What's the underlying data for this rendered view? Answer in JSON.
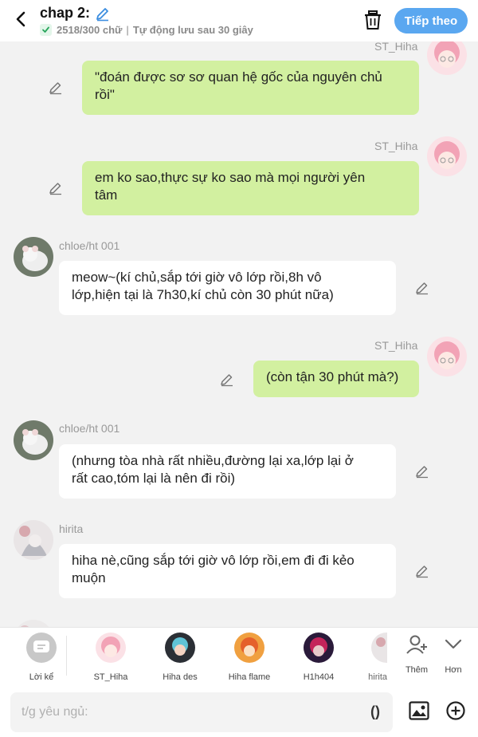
{
  "header": {
    "title": "chap 2:",
    "word_count": "2518/300 chữ",
    "separator": "|",
    "autosave": "Tự động lưu sau 30 giây",
    "next_label": "Tiếp theo",
    "accent": "#5aa7f0"
  },
  "messages": [
    {
      "side": "right",
      "name": "ST_Hiha",
      "lines": [
        "\"đoán được sơ sơ quan hệ gốc của nguyên chủ",
        "rồi\""
      ]
    },
    {
      "side": "right",
      "name": "ST_Hiha",
      "lines": [
        "em ko sao,thực sự ko sao mà mọi người yên",
        "tâm"
      ]
    },
    {
      "side": "left",
      "name": "chloe/ht 001",
      "lines": [
        "meow~(kí chủ,sắp tới giờ vô lớp rồi,8h vô",
        "lớp,hiện tại là 7h30,kí chủ còn 30 phút nữa)"
      ]
    },
    {
      "side": "right",
      "name": "ST_Hiha",
      "lines": [
        "(còn tận 30 phút mà?)"
      ]
    },
    {
      "side": "left",
      "name": "chloe/ht 001",
      "lines": [
        "(nhưng tòa nhà rất nhiều,đường lại xa,lớp lại ở",
        "rất cao,tóm lại là nên đi rồi)"
      ]
    },
    {
      "side": "left",
      "name": "hirita",
      "lines": [
        "hiha nè,cũng sắp tới giờ vô lớp rồi,em đi đi kẻo",
        "muộn"
      ]
    }
  ],
  "characters": {
    "narrator": "Lời kể",
    "list": [
      "ST_Hiha",
      "Hiha des",
      "Hiha flame",
      "H1h404",
      "hirita"
    ],
    "add_label": "Thêm",
    "more_label": "Hơn"
  },
  "input": {
    "placeholder": "t/g yêu ngủ:",
    "paren": "()"
  }
}
